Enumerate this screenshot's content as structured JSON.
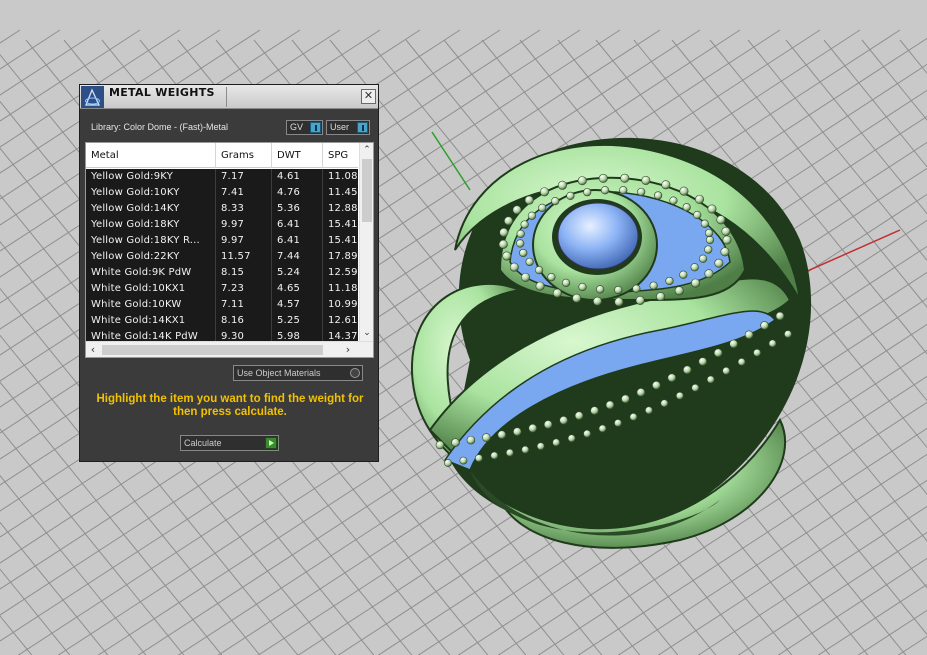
{
  "panel": {
    "title": "METAL WEIGHTS",
    "close_glyph": "✕",
    "library_label": "Library: Color Dome - (Fast)-Metal",
    "toggle_gv_label": "GV",
    "toggle_user_label": "User",
    "use_object_materials_label": "Use Object Materials",
    "hint_text": "Highlight the item you want to find the weight for then press calculate.",
    "calculate_label": "Calculate",
    "icons": [
      "app-logo-icon",
      "close-icon",
      "toggle-icon",
      "radio-icon",
      "play-icon",
      "chevron-up-icon",
      "chevron-down-icon",
      "chevron-left-icon",
      "chevron-right-icon"
    ]
  },
  "table": {
    "columns": [
      "Metal",
      "Grams",
      "DWT",
      "SPG"
    ],
    "rows": [
      {
        "metal": "Yellow Gold:9KY",
        "grams": "7.17",
        "dwt": "4.61",
        "spg": "11.08"
      },
      {
        "metal": "Yellow Gold:10KY",
        "grams": "7.41",
        "dwt": "4.76",
        "spg": "11.45"
      },
      {
        "metal": "Yellow Gold:14KY",
        "grams": "8.33",
        "dwt": "5.36",
        "spg": "12.88"
      },
      {
        "metal": "Yellow Gold:18KY",
        "grams": "9.97",
        "dwt": "6.41",
        "spg": "15.41"
      },
      {
        "metal": "Yellow Gold:18KY R...",
        "grams": "9.97",
        "dwt": "6.41",
        "spg": "15.41"
      },
      {
        "metal": "Yellow Gold:22KY",
        "grams": "11.57",
        "dwt": "7.44",
        "spg": "17.89"
      },
      {
        "metal": "White Gold:9K PdW",
        "grams": "8.15",
        "dwt": "5.24",
        "spg": "12.59"
      },
      {
        "metal": "White Gold:10KX1",
        "grams": "7.23",
        "dwt": "4.65",
        "spg": "11.18"
      },
      {
        "metal": "White Gold:10KW",
        "grams": "7.11",
        "dwt": "4.57",
        "spg": "10.99"
      },
      {
        "metal": "White Gold:14KX1",
        "grams": "8.16",
        "dwt": "5.25",
        "spg": "12.61"
      },
      {
        "metal": "White Gold:14K PdW",
        "grams": "9.30",
        "dwt": "5.98",
        "spg": "14.37"
      }
    ]
  },
  "colors": {
    "viewport_bg": "#c9c9c9",
    "grid_line": "#8f8f8f",
    "ring_metal": "#a9e39f",
    "ring_shadow": "#1f3b1c",
    "gemstone": "#7aa8f0",
    "hint_text": "#f2c200",
    "panel_bg": "#3b3b3b"
  }
}
